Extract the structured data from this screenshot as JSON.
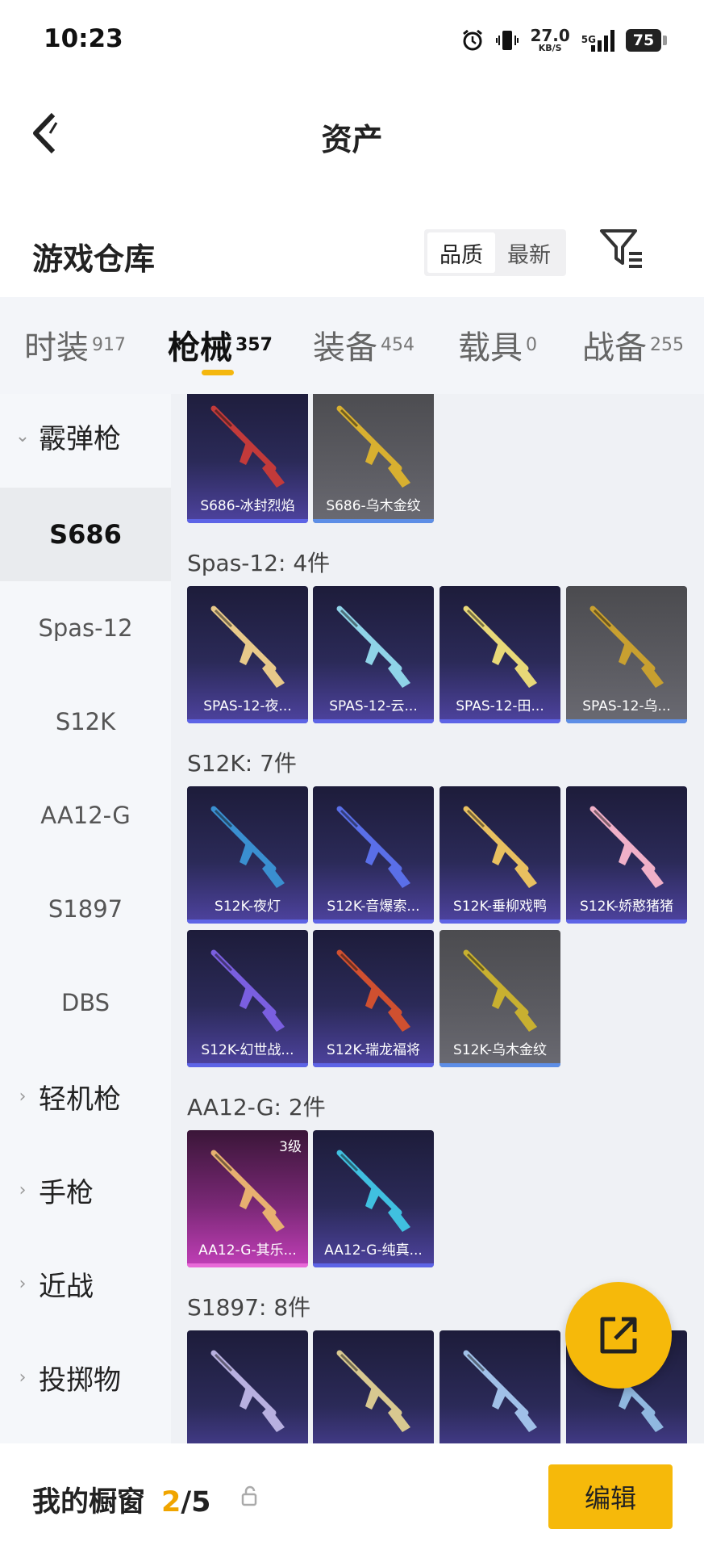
{
  "status_bar": {
    "time": "10:23",
    "net_speed": "27.0",
    "net_unit": "KB/S",
    "network": "5G",
    "battery": "75"
  },
  "nav": {
    "title": "资产"
  },
  "warehouse": {
    "title": "游戏仓库",
    "sort_options": [
      "品质",
      "最新"
    ],
    "selected_sort": "品质"
  },
  "tabs": [
    {
      "label": "时装",
      "count": "917"
    },
    {
      "label": "枪械",
      "count": "357",
      "active": true
    },
    {
      "label": "装备",
      "count": "454"
    },
    {
      "label": "载具",
      "count": "0"
    },
    {
      "label": "战备",
      "count": "255"
    }
  ],
  "sidebar": {
    "items": [
      {
        "label": "霰弹枪",
        "kind": "category",
        "expanded": true
      },
      {
        "label": "S686",
        "kind": "sub",
        "active": true
      },
      {
        "label": "Spas-12",
        "kind": "sub"
      },
      {
        "label": "S12K",
        "kind": "sub"
      },
      {
        "label": "AA12-G",
        "kind": "sub"
      },
      {
        "label": "S1897",
        "kind": "sub"
      },
      {
        "label": "DBS",
        "kind": "sub"
      },
      {
        "label": "轻机枪",
        "kind": "category"
      },
      {
        "label": "手枪",
        "kind": "category"
      },
      {
        "label": "近战",
        "kind": "category"
      },
      {
        "label": "投掷物",
        "kind": "category"
      }
    ]
  },
  "sections": [
    {
      "header": "",
      "items": [
        {
          "label": "S686-冰封烈焰",
          "color": "#c23a3a"
        },
        {
          "label": "S686-乌木金纹",
          "color": "#d8b030",
          "gray": true
        }
      ]
    },
    {
      "header": "Spas-12: 4件",
      "items": [
        {
          "label": "SPAS-12-夜...",
          "color": "#e8c98a"
        },
        {
          "label": "SPAS-12-云...",
          "color": "#8fd3e8"
        },
        {
          "label": "SPAS-12-田...",
          "color": "#e8d878"
        },
        {
          "label": "SPAS-12-乌...",
          "color": "#c8a030",
          "gray": true
        }
      ]
    },
    {
      "header": "S12K: 7件",
      "items": [
        {
          "label": "S12K-夜灯",
          "color": "#3a8fd0"
        },
        {
          "label": "S12K-音爆索...",
          "color": "#5a6fe8"
        },
        {
          "label": "S12K-垂柳戏鸭",
          "color": "#e8c060"
        },
        {
          "label": "S12K-娇憨猪猪",
          "color": "#f0b0c8"
        },
        {
          "label": "S12K-幻世战...",
          "color": "#7a5fe0"
        },
        {
          "label": "S12K-瑞龙福将",
          "color": "#d05030"
        },
        {
          "label": "S12K-乌木金纹",
          "color": "#c8b030",
          "gray": true
        }
      ]
    },
    {
      "header": "AA12-G: 2件",
      "items": [
        {
          "label": "AA12-G-其乐...",
          "color": "#e8b070",
          "pink": true,
          "level": "3级"
        },
        {
          "label": "AA12-G-纯真...",
          "color": "#40c0e0"
        }
      ]
    },
    {
      "header": "S1897: 8件",
      "items": [
        {
          "label": "",
          "color": "#b8b0e0"
        },
        {
          "label": "",
          "color": "#d8c890"
        },
        {
          "label": "",
          "color": "#a0c0e8"
        },
        {
          "label": "",
          "color": "#90b8e0"
        }
      ]
    }
  ],
  "bottom": {
    "showcase_label": "我的橱窗",
    "count_current": "2",
    "count_total": "/5",
    "edit_label": "编辑"
  }
}
